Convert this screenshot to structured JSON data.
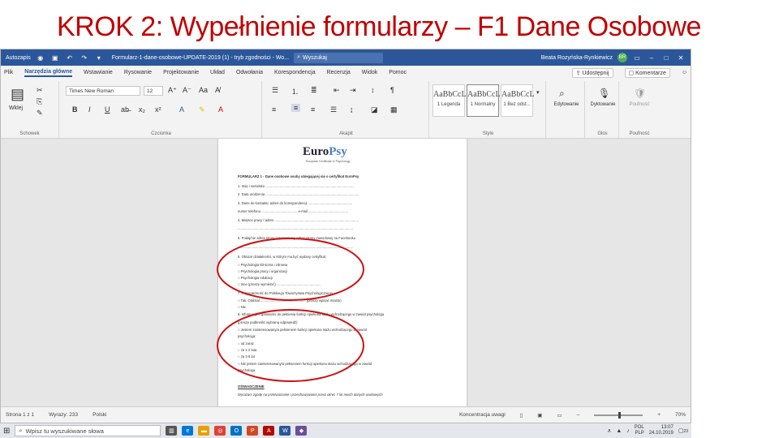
{
  "slide": {
    "title": "KROK 2: Wypełnienie formularzy – F1 Dane Osobowe"
  },
  "titlebar": {
    "autosave": "Autozapis",
    "doc_title": "Formularz-1-dane-osobowe-UPDATE-2019 (1) - tryb zgodności - Wo...",
    "search_placeholder": "Wyszukaj",
    "user": "Beata Rozyńska-Rynkiewicz",
    "user_initials": "BR"
  },
  "menu": {
    "tabs": [
      "Plik",
      "Narzędzia główne",
      "Wstawianie",
      "Rysowanie",
      "Projektowanie",
      "Układ",
      "Odwołania",
      "Korespondencja",
      "Recenzja",
      "Widok",
      "Pomoc"
    ],
    "share": "Udostępnij",
    "comments": "Komentarze"
  },
  "ribbon": {
    "paste": "Wklej",
    "font_name": "Times New Roman",
    "font_size": "12",
    "groups": {
      "clipboard": "Schowek",
      "font": "Czcionka",
      "paragraph": "Akapit",
      "styles": "Style",
      "voice": "Głos",
      "sensitivity": "Poufność"
    },
    "styles": [
      {
        "sample": "AaBbCcL",
        "name": "1 Legenda"
      },
      {
        "sample": "AaBbCcL",
        "name": "1 Normalny"
      },
      {
        "sample": "AaBbCcL",
        "name": "1 Bez odst..."
      }
    ],
    "edit": "Edytowanie",
    "dictate": "Dyktowanie",
    "sensitivity_btn": "Poufność",
    "bold": "B",
    "italic": "I",
    "underline": "U"
  },
  "document": {
    "logo_main": "Euro",
    "logo_accent": "Psy",
    "logo_sub": "European Certificate in Psychology",
    "heading": "FORMULARZ 1 - Dane osobowe osoby ubiegającej się o certyfikat EuroPsy",
    "lines": [
      "1.   Imię i nazwisko ..............................................................................................",
      "2.   Data urodzenia ...................................................................................................",
      "3.   Dane do kontaktu: adres do korespondencji ...............................................",
      "      numer telefonu ...................................... e-mail ..........................................",
      "4.   Miejsce pracy / adres .........................................................................................",
      "      ..........................................................................................................................",
      "5.   Podaj/nie adres strony internetowej, adres strony zawodowej na Facebooku",
      "      ..........................................................................................................................",
      "6.   Obszar działalności, w którym ma być wydany certyfikat:",
      "      □   Psychologia kliniczna i zdrowia",
      "      □   Psychologia pracy i organizacji",
      "      □   Psychologia edukacji",
      "      □   Inne (proszę wymienić) ...............................................",
      "7.   Przynależność do Polskiego Towarzystwa Psychologicznego",
      "      □   Tak, Oddział ................................................ (proszę wpisać miasto)",
      "      □   Nie",
      "8.   Informacja o gotowości do pełnienia funkcji opiekuna stażu wchodzącego w zawód psychologa",
      "      (proszę podkreślić wybraną odpowiedź)",
      "      □   Jestem zainteresowany/a pełnieniem funkcji opiekuna stażu wchodzącego w zawód",
      "           psychologa:",
      "             ○   od zaraz",
      "             ○   za 1-2 lata",
      "             ○   za 3-5 lat",
      "      □   Nie jestem zainteresowany/a pełnieniem funkcji opiekuna stażu wchodzącego w zawód",
      "           psychologa",
      "OŚWIADCZENIE",
      "Wyrażam zgodę na przetwarzanie i przechowywanie przez okres 7 lat moich danych osobowych"
    ]
  },
  "status": {
    "page": "Strona 1 z 1",
    "words": "Wyrazy: 233",
    "lang": "Polski",
    "focus": "Koncentracja uwagi",
    "zoom": "70%"
  },
  "taskbar": {
    "search": "Wpisz tu wyszukiwane słowa",
    "lang": "POL",
    "lang2": "PLP",
    "time": "13:07",
    "date": "24.10.2019",
    "notif": "23"
  },
  "colors": {
    "title": "#c00000",
    "word_blue": "#2b579a",
    "annotation": "#cc1111"
  }
}
